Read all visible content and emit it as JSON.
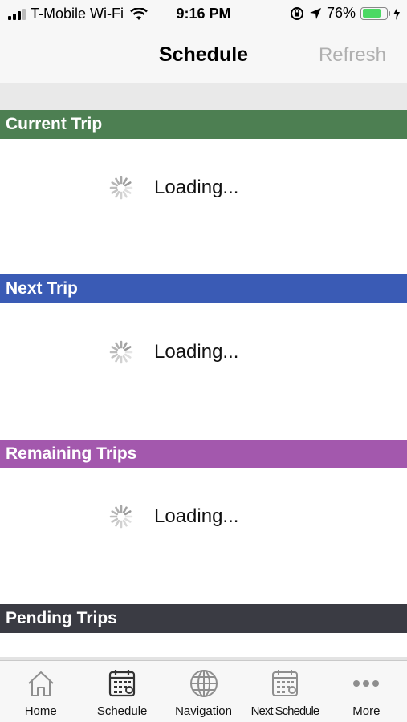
{
  "status_bar": {
    "carrier": "T-Mobile Wi-Fi",
    "time": "9:16 PM",
    "battery_percent": "76%",
    "battery_level": 0.76
  },
  "nav": {
    "title": "Schedule",
    "refresh_label": "Refresh"
  },
  "sections": {
    "current": {
      "title": "Current Trip",
      "loading_text": "Loading..."
    },
    "next": {
      "title": "Next Trip",
      "loading_text": "Loading..."
    },
    "remaining": {
      "title": "Remaining Trips",
      "loading_text": "Loading..."
    },
    "pending": {
      "title": "Pending Trips"
    }
  },
  "colors": {
    "current_header": "#4d7f52",
    "next_header": "#3a5bb5",
    "remaining_header": "#a358ad",
    "pending_header": "#3a3b43"
  },
  "tabs": [
    {
      "label": "Home",
      "icon": "home-icon"
    },
    {
      "label": "Schedule",
      "icon": "calendar-icon"
    },
    {
      "label": "Navigation",
      "icon": "globe-icon"
    },
    {
      "label": "Next Schedule",
      "icon": "calendar-icon"
    },
    {
      "label": "More",
      "icon": "more-dots-icon"
    }
  ]
}
